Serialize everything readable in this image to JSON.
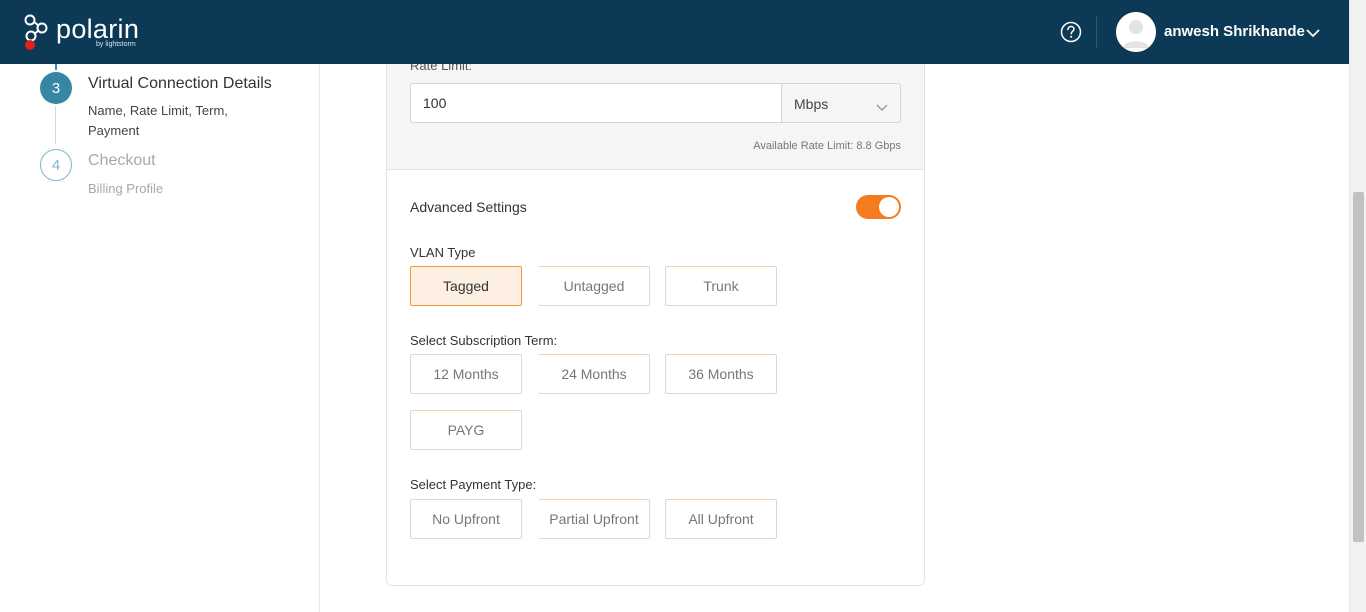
{
  "header": {
    "logo_text": "polarin",
    "logo_sub": "by lightstorm",
    "help_icon": "help-circle-icon",
    "user_name": "anwesh Shrikhande",
    "colors": {
      "bg": "#0c3a56",
      "logo_dot": "#e0221f"
    }
  },
  "steps": [
    {
      "number": "3",
      "title": "Virtual Connection Details",
      "subtitle": "Name, Rate Limit, Term, Payment",
      "state": "active"
    },
    {
      "number": "4",
      "title": "Checkout",
      "subtitle": "Billing Profile",
      "state": "pending"
    }
  ],
  "rate": {
    "label": "Rate Limit:",
    "value": "100",
    "unit": "Mbps",
    "available": "Available Rate Limit: 8.8 Gbps"
  },
  "advanced": {
    "label": "Advanced Settings",
    "toggle_on": true,
    "accent_color": "#f47b20"
  },
  "vlan": {
    "label": "VLAN Type",
    "options": [
      "Tagged",
      "Untagged",
      "Trunk"
    ],
    "selected": "Tagged"
  },
  "term": {
    "label": "Select Subscription Term:",
    "options": [
      "12 Months",
      "24 Months",
      "36 Months",
      "PAYG"
    ]
  },
  "payment": {
    "label": "Select Payment Type:",
    "options": [
      "No Upfront",
      "Partial Upfront",
      "All Upfront"
    ]
  }
}
